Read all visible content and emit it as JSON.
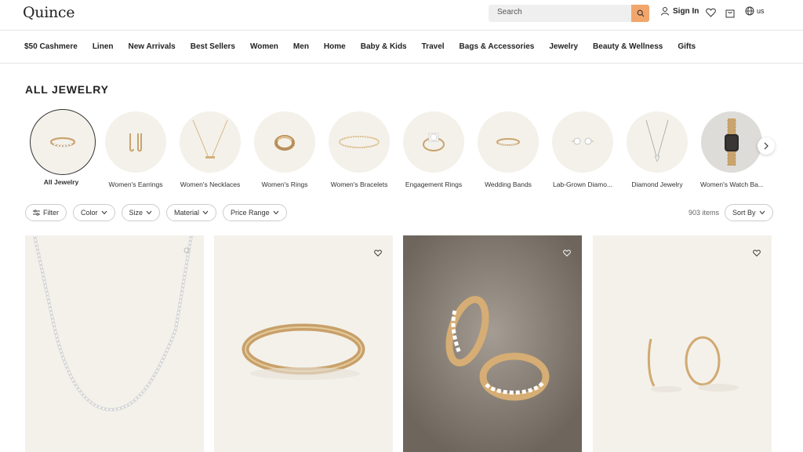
{
  "header": {
    "logo": "Quince",
    "search_label": "Search",
    "signin_label": "Sign In",
    "region_label": "us"
  },
  "nav": {
    "items": [
      "$50 Cashmere",
      "Linen",
      "New Arrivals",
      "Best Sellers",
      "Women",
      "Men",
      "Home",
      "Baby & Kids",
      "Travel",
      "Bags & Accessories",
      "Jewelry",
      "Beauty & Wellness",
      "Gifts"
    ]
  },
  "page": {
    "title": "ALL JEWELRY"
  },
  "categories": [
    {
      "label": "All Jewelry",
      "active": true,
      "icon": "ring-band-icon"
    },
    {
      "label": "Women's Earrings",
      "active": false,
      "icon": "earrings-icon"
    },
    {
      "label": "Women's Necklaces",
      "active": false,
      "icon": "necklace-icon"
    },
    {
      "label": "Women's Rings",
      "active": false,
      "icon": "ring-icon"
    },
    {
      "label": "Women's Bracelets",
      "active": false,
      "icon": "bracelet-icon"
    },
    {
      "label": "Engagement Rings",
      "active": false,
      "icon": "engagement-ring-icon"
    },
    {
      "label": "Wedding Bands",
      "active": false,
      "icon": "wedding-band-icon"
    },
    {
      "label": "Lab-Grown Diamo...",
      "active": false,
      "icon": "stud-earrings-icon"
    },
    {
      "label": "Diamond Jewelry",
      "active": false,
      "icon": "pendant-icon"
    },
    {
      "label": "Women's Watch Ba...",
      "active": false,
      "icon": "watch-icon"
    }
  ],
  "filters": {
    "filter_label": "Filter",
    "chips": [
      "Color",
      "Size",
      "Material",
      "Price Range"
    ],
    "items_count": "903 items",
    "sort_label": "Sort By"
  },
  "products": [
    {
      "name": "tennis-necklace",
      "heart": false
    },
    {
      "name": "bangle-bracelet",
      "heart": true
    },
    {
      "name": "diamond-hoops",
      "heart": true
    },
    {
      "name": "gold-hoops",
      "heart": true
    }
  ],
  "colors": {
    "accent": "#f2a66b",
    "card_bg": "#f4f1ea",
    "gold": "#d4b07a"
  }
}
